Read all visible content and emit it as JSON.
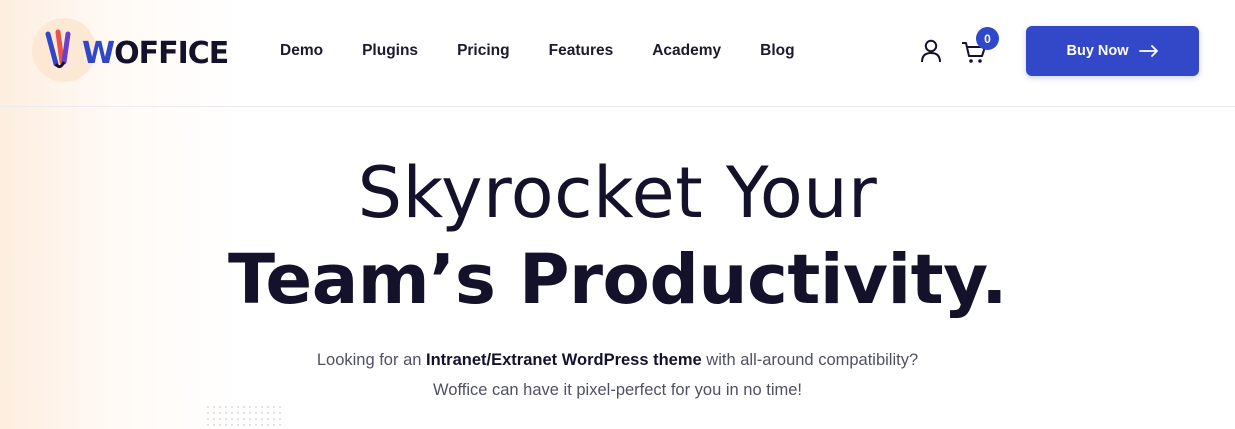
{
  "header": {
    "logo_text_w": "W",
    "logo_text_rest": "OFFICE",
    "nav": [
      "Demo",
      "Plugins",
      "Pricing",
      "Features",
      "Academy",
      "Blog"
    ],
    "cart_count": "0",
    "buy_label": "Buy Now",
    "icons": [
      "user-icon",
      "cart-icon",
      "arrow-right-icon"
    ]
  },
  "hero": {
    "line1": "Skyrocket Your",
    "line2": "Team’s Productivity.",
    "sub1_pre": "Looking for an ",
    "sub1_bold": "Intranet/Extranet WordPress theme",
    "sub1_post": " with all-around compatibility?",
    "sub2": "Woffice can have it pixel-perfect for you in no time!"
  },
  "colors": {
    "accent": "#3248c8",
    "text": "#14122b",
    "muted": "#505063",
    "logo_bg": "#fde8d6"
  }
}
